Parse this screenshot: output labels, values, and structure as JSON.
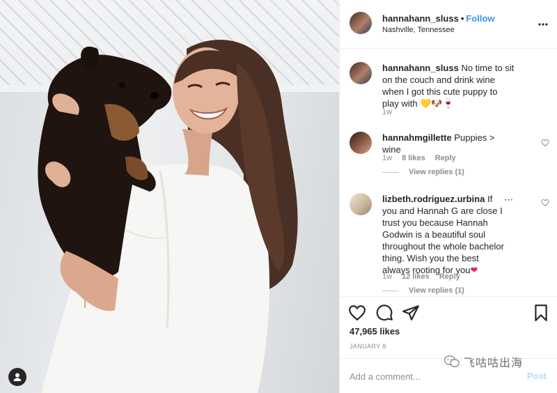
{
  "post": {
    "author": {
      "username": "hannahann_sluss",
      "separator": "•",
      "follow_label": "Follow",
      "location": "Nashville, Tennessee"
    },
    "caption": {
      "username": "hannahann_sluss",
      "text": "No time to sit on the couch and drink wine when I got this cute puppy to play with",
      "emoji": "💛🐶🍷",
      "time": "1w"
    },
    "comments": [
      {
        "username": "hannahmgillette",
        "text": "Puppies > wine",
        "time": "1w",
        "likes": "8 likes",
        "reply_label": "Reply",
        "view_replies": "View replies (1)"
      },
      {
        "username": "lizbeth.rodriguez.urbina",
        "text": "If you and Hannah G are close I trust you because Hannah Godwin is a beautiful soul throughout the whole bachelor thing. Wish you the best always rooting for you",
        "emoji": "❤",
        "more_icon": "⋯",
        "time": "1w",
        "likes": "12 likes",
        "reply_label": "Reply",
        "view_replies": "View replies (1)"
      }
    ],
    "likes_count": "47,965 likes",
    "date": "JANUARY 8",
    "add_comment_placeholder": "Add a comment...",
    "post_button": "Post",
    "watermark": "飞咕咕出海",
    "icons": {
      "more": "more-options-icon",
      "like": "heart-icon",
      "comment": "comment-icon",
      "share": "share-icon",
      "save": "bookmark-icon",
      "tagged": "user-tag-icon"
    },
    "colors": {
      "link": "#3897f0",
      "text": "#262626",
      "muted": "#8e8e8e",
      "post_disabled": "#b2dffc"
    }
  }
}
